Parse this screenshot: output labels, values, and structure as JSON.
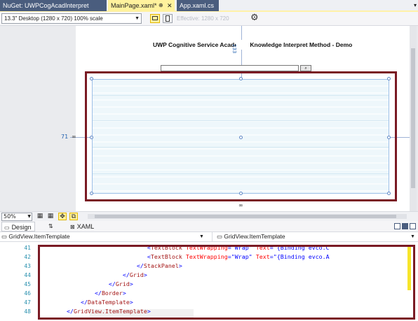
{
  "tabs": [
    {
      "label": "NuGet: UWPCogAcadInterpret",
      "active": false
    },
    {
      "label": "MainPage.xaml*",
      "active": true,
      "pin": "⊕",
      "close": "✕"
    },
    {
      "label": "App.xaml.cs",
      "active": false
    }
  ],
  "tab_overflow": "▾",
  "designer_toolbar": {
    "device": "13.3\" Desktop (1280 x 720) 100% scale",
    "effective": "Effective: 1280 x 720"
  },
  "design_surface": {
    "app_title": "UWP Cognitive Service Acader",
    "app_title_rest": "Knowledge Interpret Method - Demo",
    "guide_label": "233",
    "margin_left": "71",
    "link_glyph": "∞"
  },
  "zoom": {
    "value": "50%"
  },
  "view_tabs": {
    "design": "Design",
    "swap": "⇅",
    "xaml": "XAML"
  },
  "nav": {
    "left": "GridView.ItemTemplate",
    "right": "GridView.ItemTemplate"
  },
  "code_lines": [
    {
      "num": "41",
      "indent": "                              ",
      "text": "<TextBlock TextWrapping=\"Wrap\" Text=\"{Binding evco.C"
    },
    {
      "num": "42",
      "indent": "                              ",
      "text": "<TextBlock TextWrapping=\"Wrap\" Text=\"{Binding evco.A"
    },
    {
      "num": "43",
      "indent": "                           ",
      "text": "</StackPanel>"
    },
    {
      "num": "44",
      "indent": "                       ",
      "text": "</Grid>"
    },
    {
      "num": "45",
      "indent": "                   ",
      "text": "</Grid>"
    },
    {
      "num": "46",
      "indent": "               ",
      "text": "</Border>"
    },
    {
      "num": "47",
      "indent": "           ",
      "text": "</DataTemplate>"
    },
    {
      "num": "48",
      "indent": "       ",
      "text": "</GridView.ItemTemplate>"
    }
  ],
  "colors": {
    "highlight_border": "#7a1a24",
    "active_tab": "#fff29d",
    "inactive_tab": "#4a5d7e"
  }
}
